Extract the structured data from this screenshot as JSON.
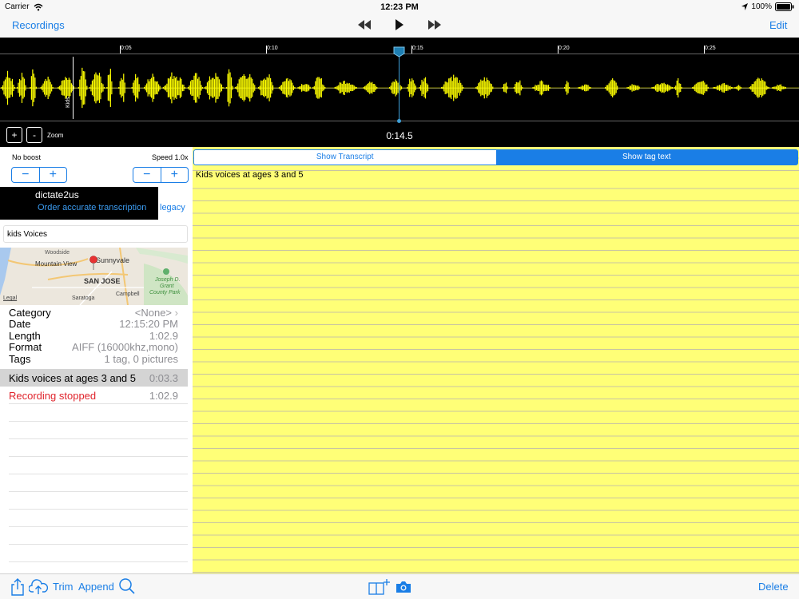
{
  "status": {
    "carrier": "Carrier",
    "time": "12:23 PM",
    "battery": "100%"
  },
  "nav": {
    "recordings": "Recordings",
    "edit": "Edit"
  },
  "waveform": {
    "ticks": [
      "0:05",
      "0:10",
      "0:15",
      "0:20",
      "0:25"
    ],
    "tag_label": "Kids",
    "position_time": "0:14.5",
    "zoom_plus": "+",
    "zoom_minus": "-",
    "zoom_label": "Zoom"
  },
  "controls": {
    "boost_label": "No boost",
    "speed_label": "Speed 1.0x",
    "minus": "−",
    "plus": "+"
  },
  "dictate": {
    "title": "dictate2us",
    "order": "Order accurate transcription",
    "legacy": "legacy"
  },
  "recording": {
    "name": "kids Voices"
  },
  "map": {
    "labels": [
      "Woodside",
      "Sunnyvale",
      "Mountain View",
      "SAN JOSE",
      "Joseph D.",
      "Grant",
      "County Park",
      "Campbell",
      "Saratoga",
      "Legal"
    ]
  },
  "info": [
    {
      "label": "Category",
      "value": "<None>"
    },
    {
      "label": "Date",
      "value": "12:15:20 PM"
    },
    {
      "label": "Length",
      "value": "1:02.9"
    },
    {
      "label": "Format",
      "value": "AIFF (16000khz,mono)"
    },
    {
      "label": "Tags",
      "value": "1 tag, 0 pictures"
    }
  ],
  "tags": [
    {
      "text": "Kids voices at ages 3 and 5",
      "time": "0:03.3"
    },
    {
      "text": "Recording stopped",
      "time": "1:02.9"
    }
  ],
  "segmented": {
    "transcript": "Show Transcript",
    "tag_text": "Show tag text"
  },
  "note_text": "Kids voices at ages 3 and 5",
  "toolbar": {
    "trim": "Trim",
    "append": "Append",
    "delete": "Delete"
  },
  "colors": {
    "accent": "#1a7ee6",
    "waveform": "#ffff00",
    "note": "#ffff77",
    "stopped": "#e0242c"
  }
}
